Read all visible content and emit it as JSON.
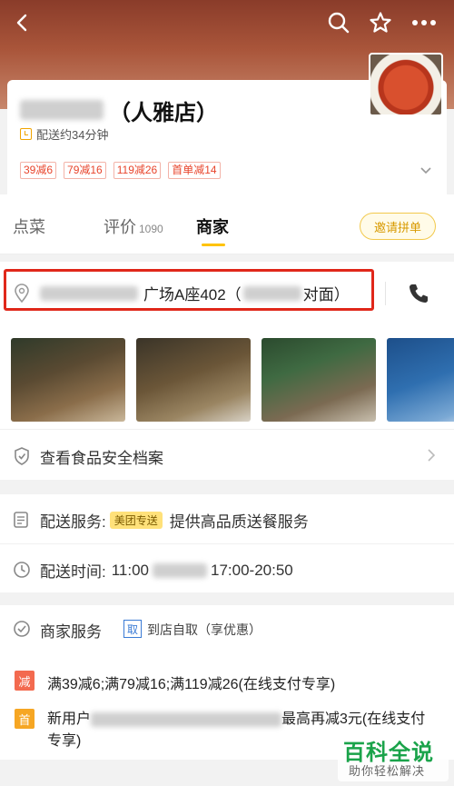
{
  "store": {
    "name_suffix": "（人雅店）",
    "delivery_time": "配送约34分钟"
  },
  "promos": [
    "39减6",
    "79减16",
    "119减26",
    "首单减14"
  ],
  "tabs": {
    "order": "点菜",
    "reviews": "评价",
    "reviews_count": "1090",
    "merchant": "商家",
    "group_order": "邀请拼单"
  },
  "merchant": {
    "address_visible": "广场A座402（",
    "address_tail": "对面）",
    "food_safety": "查看食品安全档案"
  },
  "delivery": {
    "service_label": "配送服务:",
    "service_badge": "美团专送",
    "service_text": "提供高品质送餐服务",
    "time_label": "配送时间:",
    "time_start": "11:00",
    "time_end": "17:00-20:50"
  },
  "merchant_service": {
    "title": "商家服务",
    "pickup_badge": "取",
    "pickup_text": "到店自取（享优惠）",
    "reduce_badge": "减",
    "reduce_text": "满39减6;满79减16;满119减26(在线支付专享)",
    "first_badge": "首",
    "first_prefix": "新用户",
    "first_suffix": "最高再减3元(在线支付专享)"
  },
  "watermark": {
    "main": "百科全说",
    "sub": "助你轻松解决"
  },
  "colors": {
    "accent": "#ffc300",
    "promo_red": "#e8452c",
    "highlight_border": "#e0271a",
    "watermark_green": "#1aa34a"
  }
}
